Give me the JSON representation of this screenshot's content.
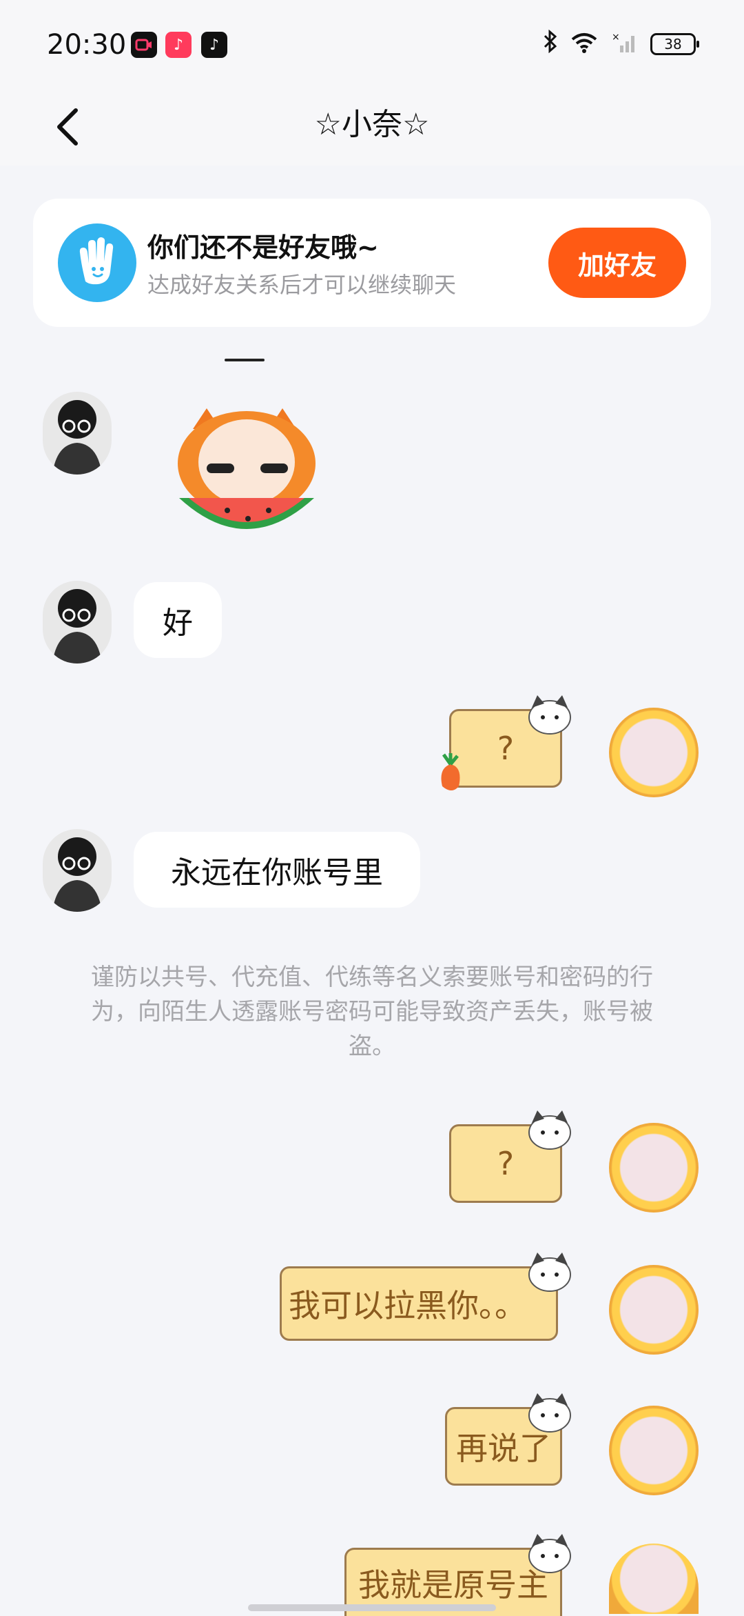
{
  "status_bar": {
    "time": "20:30",
    "battery": "38",
    "icons": [
      "screen-record-icon",
      "music-icon",
      "tiktok-icon",
      "bluetooth-icon",
      "wifi-icon",
      "signal-icon",
      "battery-icon"
    ]
  },
  "header": {
    "title": "☆小奈☆",
    "back_icon": "chevron-left-icon"
  },
  "friend_banner": {
    "title": "你们还不是好友哦~",
    "subtitle": "达成好友关系后才可以继续聊天",
    "button_label": "加好友",
    "icon": "hand-wave-icon",
    "accent": "#ff5a14"
  },
  "messages": [
    {
      "from": "them",
      "type": "sticker",
      "sticker": "watermelon-cat-sticker"
    },
    {
      "from": "them",
      "type": "text",
      "text": "好"
    },
    {
      "from": "me",
      "type": "text",
      "text": "?"
    },
    {
      "from": "them",
      "type": "text",
      "text": "永远在你账号里"
    },
    {
      "from": "system",
      "type": "notice",
      "text": "谨防以共号、代充值、代练等名义索要账号和密码的行为，向陌生人透露账号密码可能导致资产丢失，账号被盗。"
    },
    {
      "from": "me",
      "type": "text",
      "text": "?"
    },
    {
      "from": "me",
      "type": "text",
      "text": "我可以拉黑你。。"
    },
    {
      "from": "me",
      "type": "text",
      "text": "再说了"
    },
    {
      "from": "me",
      "type": "text",
      "text": "我就是原号主"
    }
  ]
}
